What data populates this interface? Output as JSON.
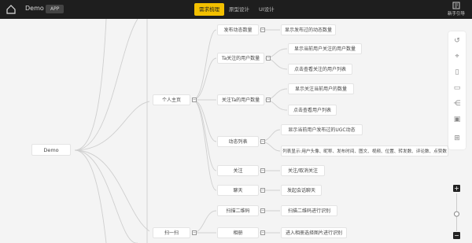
{
  "header": {
    "app_name": "Demo",
    "app_badge": "APP",
    "tabs": [
      "需求梳理",
      "原型设计",
      "UI设计"
    ],
    "guide_label": "新手引导"
  },
  "mindmap": {
    "root": "Demo",
    "personal_home": "个人主页",
    "posted_count": "发布动态数量",
    "posted_count_detail": "显示发布过的动态数量",
    "following_count": "Ta关注的用户数量",
    "following_show": "显示当前用户关注的用户数量",
    "following_click": "点击查看关注的用户列表",
    "followers_count": "关注Ta的用户数量",
    "followers_show": "显示关注当前用户的数量",
    "followers_click": "点击查看用户列表",
    "post_list": "动态列表",
    "post_list_ugc": "显示当前用户发布过的UGC动态",
    "post_list_fields": "列表显示:用户头像、昵称、发布时间、图文、视频、位置、转发数、评论数、点赞数",
    "follow": "关注",
    "follow_detail": "关注/取消关注",
    "chat": "聊天",
    "chat_detail": "发起会话聊天",
    "scan": "扫一扫",
    "scan_qr": "扫描二维码",
    "scan_qr_detail": "扫描二维码进行识别",
    "album": "相册",
    "album_detail": "进入相册选择图片进行识别"
  },
  "zoom": {
    "plus": "+",
    "minus": "−",
    "level": 0.45
  }
}
